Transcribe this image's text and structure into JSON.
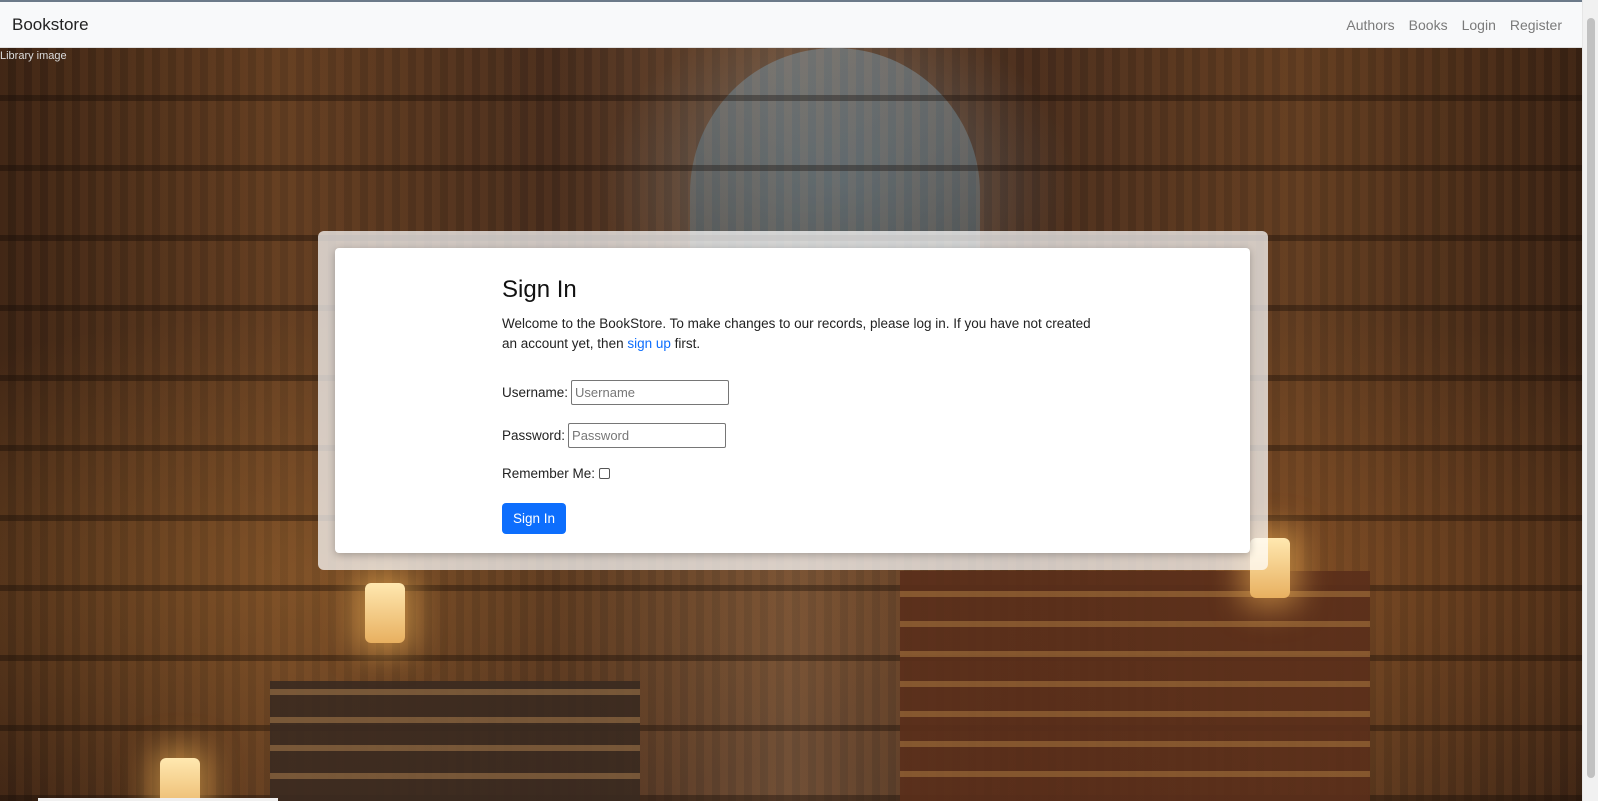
{
  "navbar": {
    "brand": "Bookstore",
    "links": [
      "Authors",
      "Books",
      "Login",
      "Register"
    ]
  },
  "hero": {
    "broken_image_alt": "Library image"
  },
  "signin": {
    "title": "Sign In",
    "intro_before": "Welcome to the BookStore. To make changes to our records, please log in. If you have not created an account yet, then ",
    "intro_link": "sign up",
    "intro_after": " first.",
    "username_label": "Username:",
    "username_placeholder": "Username",
    "username_value": "",
    "password_label": "Password:",
    "password_placeholder": "Password",
    "password_value": "",
    "remember_label": "Remember Me:",
    "remember_checked": false,
    "submit_label": "Sign In"
  },
  "colors": {
    "accent": "#0d6efd",
    "navbar_bg": "#f8f9fa"
  }
}
